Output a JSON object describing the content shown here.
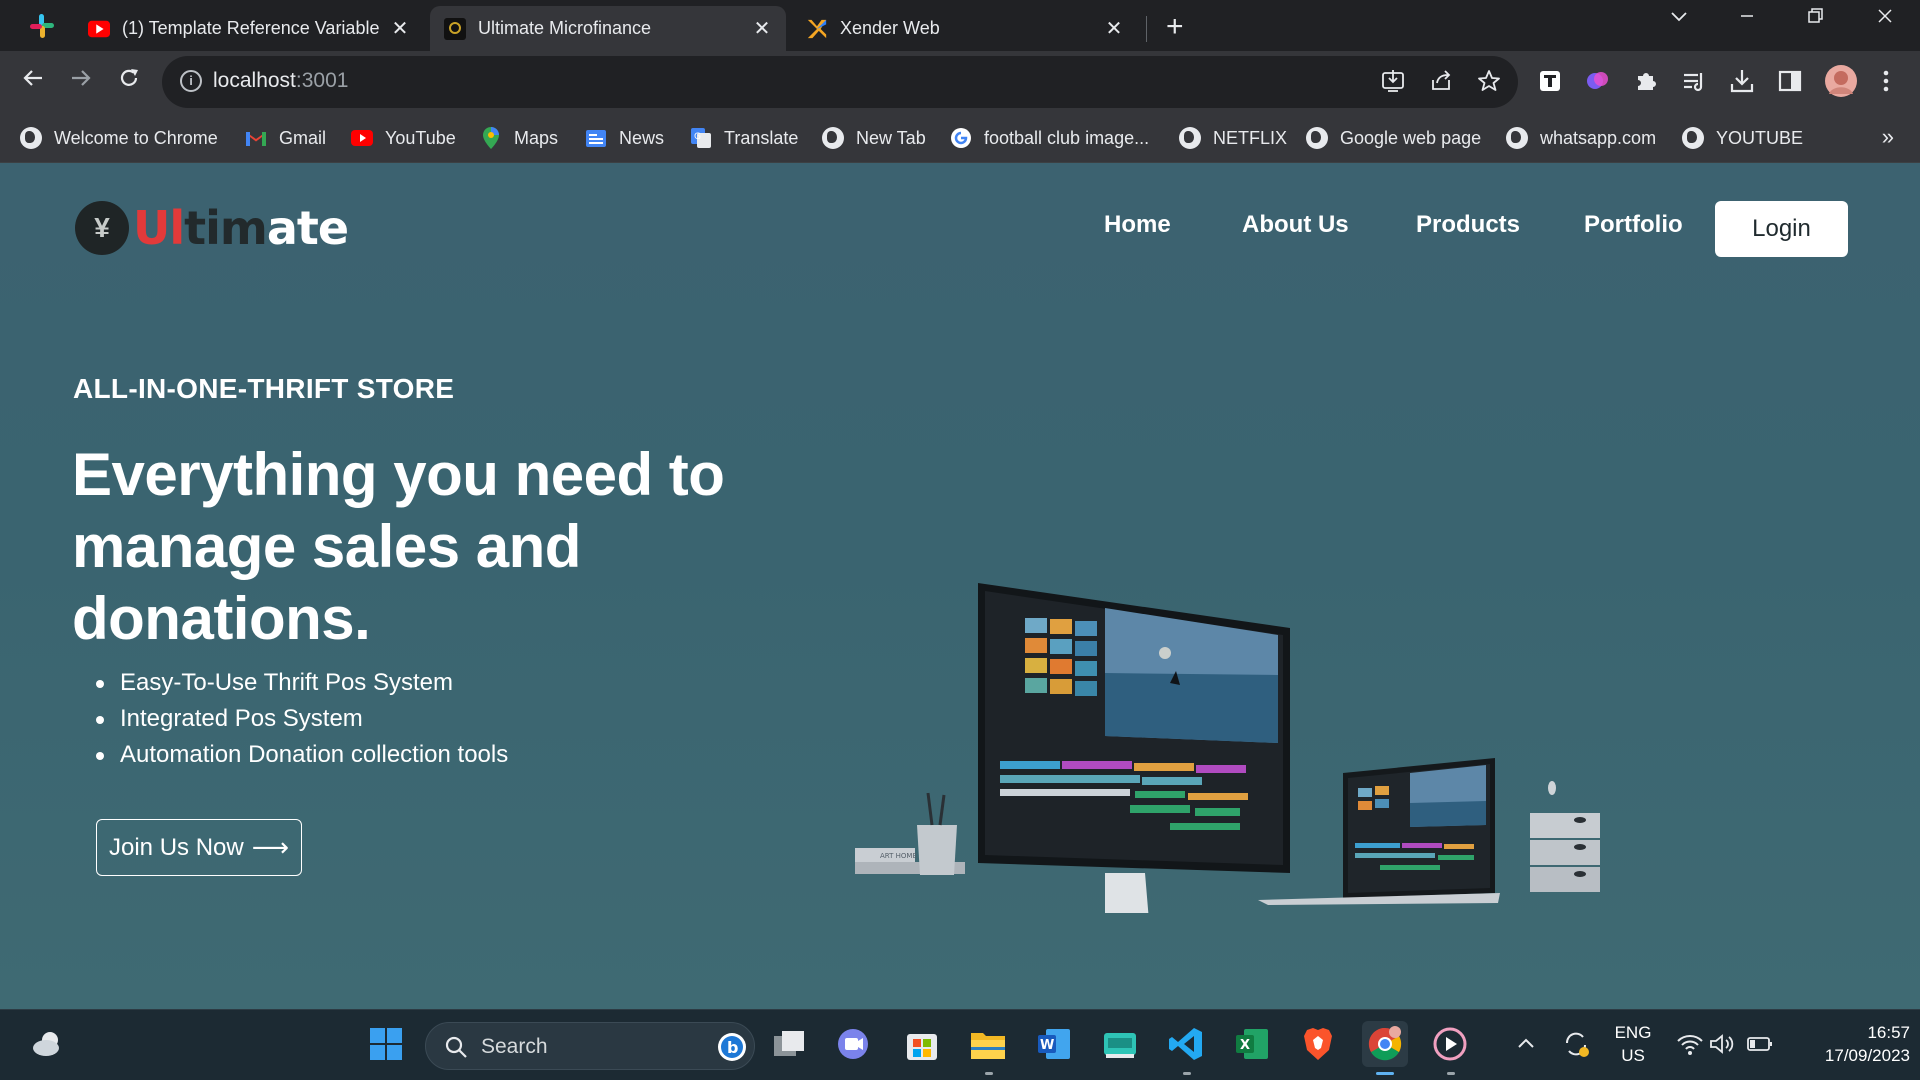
{
  "browser": {
    "tabs": [
      {
        "title": "(1) Template Reference Variable",
        "icon": "youtube-icon",
        "active": false
      },
      {
        "title": "Ultimate Microfinance",
        "icon": "site-logo-icon",
        "active": true
      },
      {
        "title": "Xender Web",
        "icon": "xender-icon",
        "active": false
      }
    ],
    "address": {
      "host": "localhost",
      "port": ":3001"
    },
    "bookmarks": [
      {
        "label": "Welcome to Chrome",
        "icon": "globe-icon"
      },
      {
        "label": "Gmail",
        "icon": "gmail-icon"
      },
      {
        "label": "YouTube",
        "icon": "youtube-icon"
      },
      {
        "label": "Maps",
        "icon": "maps-icon"
      },
      {
        "label": "News",
        "icon": "news-icon"
      },
      {
        "label": "Translate",
        "icon": "translate-icon"
      },
      {
        "label": "New Tab",
        "icon": "globe-icon"
      },
      {
        "label": "football club image...",
        "icon": "google-icon"
      },
      {
        "label": "NETFLIX",
        "icon": "globe-icon"
      },
      {
        "label": "Google web page",
        "icon": "globe-icon"
      },
      {
        "label": "whatsapp.com",
        "icon": "globe-icon"
      },
      {
        "label": "YOUTUBE",
        "icon": "globe-icon"
      }
    ]
  },
  "site": {
    "logo": {
      "badge": "¥",
      "part1": "Ul",
      "part2": "tim",
      "part3": "ate"
    },
    "nav": {
      "home": "Home",
      "about": "About Us",
      "products": "Products",
      "portfolio": "Portfolio",
      "login": "Login"
    },
    "hero": {
      "eyebrow": "ALL-IN-ONE-THRIFT STORE",
      "headline": "Everything you need to manage sales and donations.",
      "features": [
        "Easy-To-Use Thrift Pos System",
        "Integrated Pos System",
        "Automation Donation collection tools"
      ],
      "cta": "Join Us Now",
      "cta_arrow": "⟶",
      "image_text": "ART HOME"
    }
  },
  "taskbar": {
    "search_label": "Search",
    "language": "ENG",
    "region": "US",
    "time": "16:57",
    "date": "17/09/2023"
  },
  "colors": {
    "page_bg": "#3c6270",
    "logo_red": "#e23a3a",
    "logo_dark": "#222a2c",
    "tab_active": "#35363a",
    "taskbar_bg": "#1c2a33"
  }
}
